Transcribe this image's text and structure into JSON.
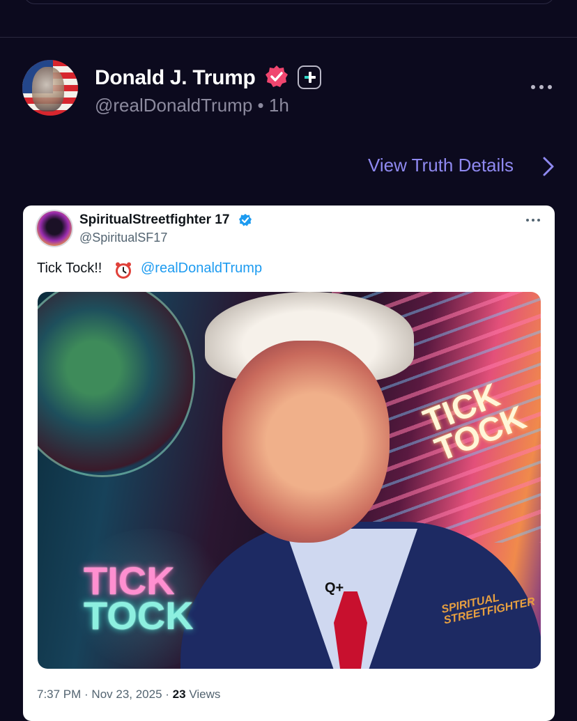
{
  "post": {
    "display_name": "Donald J. Trump",
    "handle": "@realDonaldTrump",
    "separator": "•",
    "time_ago": "1h",
    "view_details_label": "View Truth Details"
  },
  "embed": {
    "display_name": "SpiritualStreetfighter 17",
    "handle": "@SpiritualSF17",
    "text": "Tick Tock!!",
    "mention": "@realDonaldTrump",
    "image": {
      "text_left_line1": "TICK",
      "text_left_line2": "TOCK",
      "text_right_line1": "TICK",
      "text_right_line2": "TOCK",
      "pin_text": "Q+",
      "signature_line1": "SPIRITUAL",
      "signature_line2": "STREETFIGHTER"
    },
    "timestamp": "7:37 PM · Nov 23, 2025 ·",
    "views_count": "23",
    "views_label": "Views"
  },
  "colors": {
    "background": "#0c0a1e",
    "link": "#8f89f0",
    "verified_pink": "#f0466f",
    "mention_blue": "#1d9bf0"
  },
  "icons": [
    "verified-icon",
    "plus-icon",
    "more-icon",
    "chevron-right-icon",
    "alarm-clock-icon"
  ]
}
